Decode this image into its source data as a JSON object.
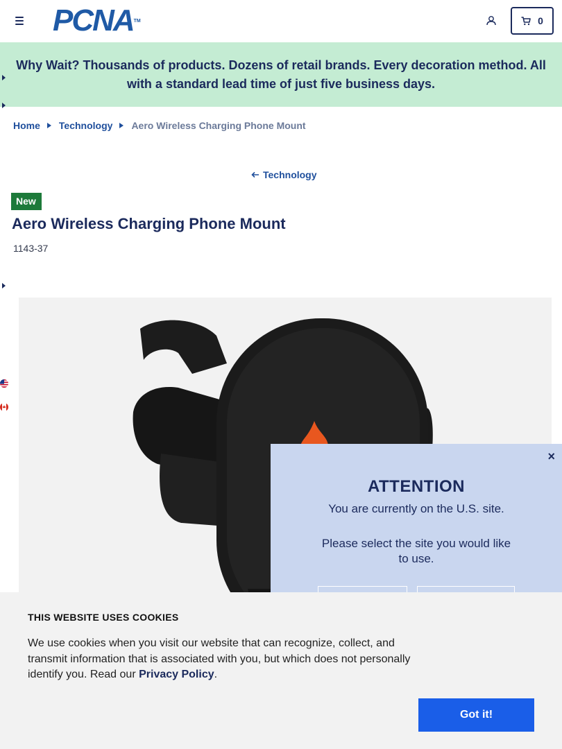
{
  "header": {
    "logo_text": "PCNA",
    "logo_tm": "TM",
    "cart_count": "0"
  },
  "banner": {
    "text": "Why Wait? Thousands of products. Dozens of retail brands. Every decoration method. All with a standard lead time of just five business days."
  },
  "breadcrumb": {
    "items": [
      "Home",
      "Technology"
    ],
    "current": "Aero Wireless Charging Phone Mount"
  },
  "back_link": "Technology",
  "product": {
    "badge": "New",
    "title": "Aero Wireless Charging Phone Mount",
    "sku": "1143-37"
  },
  "attention_modal": {
    "heading": "ATTENTION",
    "message": "You are currently on the U.S. site.",
    "prompt": "Please select the site you would like to use.",
    "close": "×"
  },
  "cookie_banner": {
    "heading": "THIS WEBSITE USES COOKIES",
    "body": "We use cookies when you visit our website that can recognize, collect, and transmit information that is associated with you, but which does not personally identify you. Read our ",
    "link": "Privacy Policy",
    "end": ".",
    "button": "Got it!"
  },
  "colors": {
    "navy": "#1b2a5c",
    "link_blue": "#1f4f9c",
    "banner_green": "#c4ecd3",
    "badge_green": "#1d7a3a",
    "modal_bg": "#c9d6ef",
    "cookie_button": "#1a5ee8"
  },
  "icons": [
    "menu-icon",
    "account-icon",
    "cart-icon",
    "chevron-right-icon",
    "arrow-left-icon",
    "us-flag-icon",
    "canada-flag-icon",
    "close-icon"
  ]
}
